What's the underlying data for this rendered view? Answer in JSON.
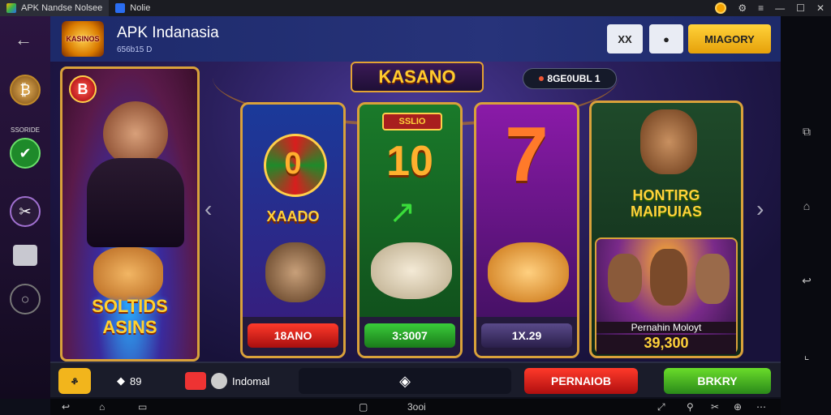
{
  "titlebar": {
    "tabs": [
      {
        "label": "APK Nandse Nolsee",
        "active": true
      },
      {
        "label": "Nolie",
        "active": false
      }
    ],
    "controls": [
      "coin-icon",
      "settings-icon",
      "menu-icon",
      "minimize-icon",
      "maximize-icon",
      "close-icon"
    ]
  },
  "sidebar": {
    "back_label": "←",
    "item_label": "SSORIDE"
  },
  "header": {
    "logo_text": "KASINOS",
    "title": "APK Indanasia",
    "subtitle": "656b15 D",
    "btn1": "XX",
    "btn2": "●",
    "btn3": "MIAGORY"
  },
  "main": {
    "banner": "KASANO",
    "pill": "8GE0UBL 1",
    "hero": {
      "badge": "B",
      "title_line1": "SOLTIDS",
      "title_line2": "ASINS"
    },
    "cards": [
      {
        "tag": "",
        "center": "0",
        "sub": "XAADO",
        "button": "18ANO",
        "btn_color": "#d81e1e"
      },
      {
        "tag": "SSLIO",
        "center": "10",
        "sub": "",
        "button": "3:3007",
        "btn_color": "#1f8a2a"
      },
      {
        "tag": "",
        "center": "7",
        "sub": "",
        "button": "1X.29",
        "btn_color": "#4a3a7a"
      }
    ],
    "featured": {
      "title_line1": "HONTIRG",
      "title_line2": "MAIPUIAS",
      "label": "Pernahin Moloyt",
      "value": "39,300"
    },
    "arrow_left": "‹",
    "arrow_right": "›"
  },
  "bottombar": {
    "count": "89",
    "region": "Indomal",
    "center_icon": "diamond-icon",
    "btn_red": "PERNAIOB",
    "btn_green": "BRKRY"
  },
  "navbar": {
    "center_text": "3ooi"
  },
  "colors": {
    "accent_gold": "#d9a13a",
    "btn_yellow": "#f2b51c",
    "btn_red": "#d81e1e",
    "btn_green": "#3a9d2a"
  }
}
